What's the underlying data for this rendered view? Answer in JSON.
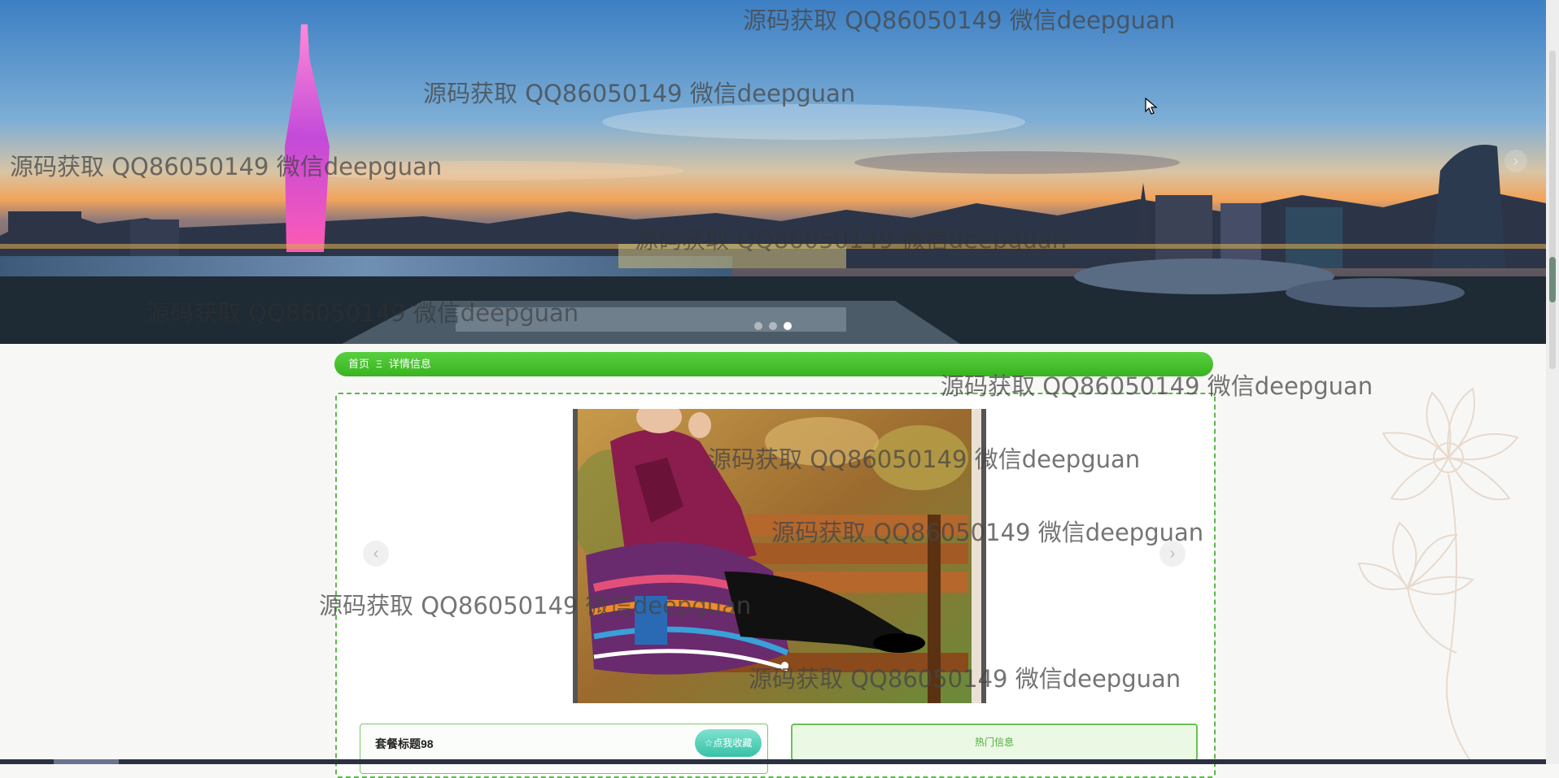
{
  "breadcrumb": {
    "home_label": "首页",
    "separator": "Ξ",
    "current_label": "详情信息"
  },
  "product": {
    "title": "套餐标题98",
    "favorite_button_label": "☆点我收藏"
  },
  "hot_info": {
    "label": "热门信息"
  },
  "hero_carousel": {
    "slide_count": 3,
    "active_index": 2,
    "next_arrow": "›"
  },
  "image_gallery": {
    "prev_arrow": "‹",
    "next_arrow": "›",
    "slide_count": 1,
    "active_index": 0
  },
  "watermark_text": "源码获取 QQ86050149 微信deepguan",
  "colors": {
    "breadcrumb_green": "#39b321",
    "border_green": "#5cb84a",
    "favorite_teal": "#37c1a6",
    "hot_info_text": "#4fae3d"
  }
}
